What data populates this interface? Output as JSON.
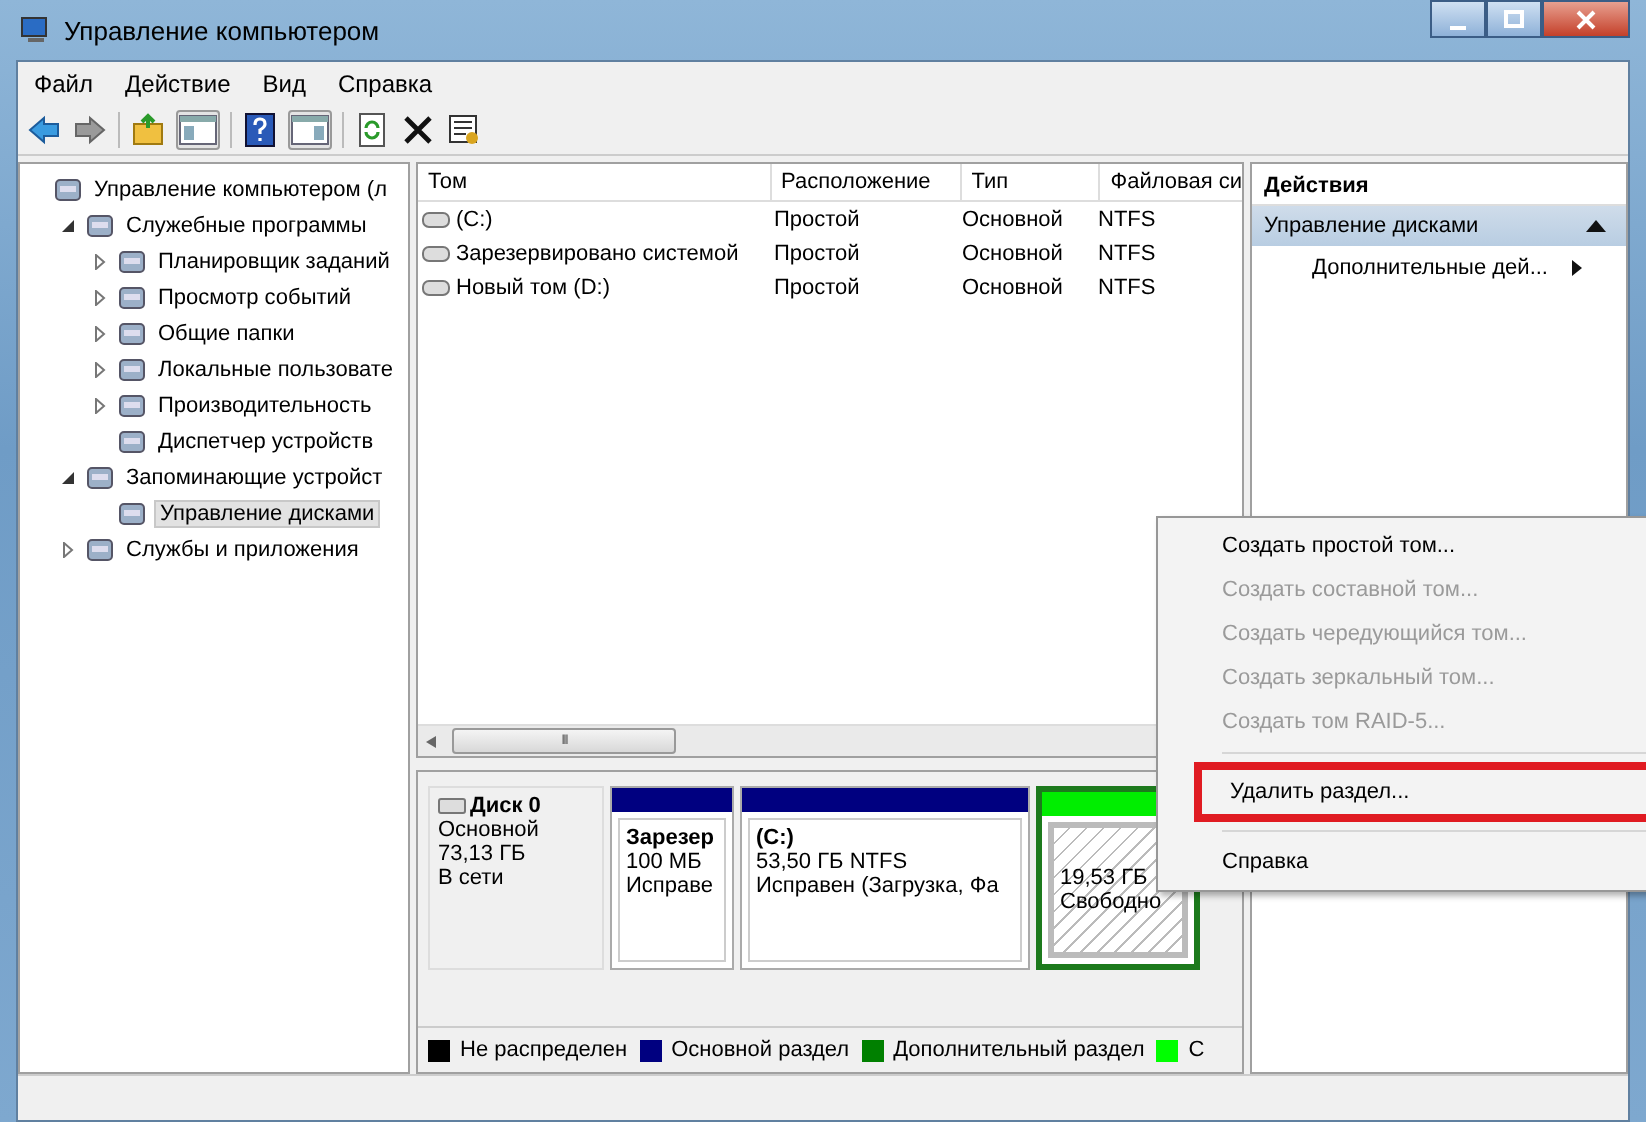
{
  "window": {
    "title": "Управление компьютером"
  },
  "menu": [
    "Файл",
    "Действие",
    "Вид",
    "Справка"
  ],
  "tree": [
    {
      "label": "Управление компьютером (л",
      "selected": false,
      "children": [
        {
          "label": "Служебные программы",
          "expanded": true,
          "selected": false,
          "children": [
            {
              "label": "Планировщик заданий",
              "expanded": false,
              "selected": false
            },
            {
              "label": "Просмотр событий",
              "expanded": false,
              "selected": false
            },
            {
              "label": "Общие папки",
              "expanded": false,
              "selected": false
            },
            {
              "label": "Локальные пользовате",
              "expanded": false,
              "selected": false
            },
            {
              "label": "Производительность",
              "expanded": false,
              "selected": false
            },
            {
              "label": "Диспетчер устройств",
              "selected": false
            }
          ]
        },
        {
          "label": "Запоминающие устройст",
          "expanded": true,
          "selected": false,
          "children": [
            {
              "label": "Управление дисками",
              "selected": true
            }
          ]
        },
        {
          "label": "Службы и приложения",
          "expanded": false,
          "selected": false
        }
      ]
    }
  ],
  "volumes": {
    "columns": [
      "Том",
      "Расположение",
      "Тип",
      "Файловая си"
    ],
    "rows": [
      [
        "(C:)",
        "Простой",
        "Основной",
        "NTFS"
      ],
      [
        "Зарезервировано системой",
        "Простой",
        "Основной",
        "NTFS"
      ],
      [
        "Новый том (D:)",
        "Простой",
        "Основной",
        "NTFS"
      ]
    ],
    "scroll_glyph": "III"
  },
  "actions": {
    "title": "Действия",
    "section": "Управление дисками",
    "items": [
      "Дополнительные дей..."
    ]
  },
  "disk": {
    "name": "Диск 0",
    "lines": [
      "Основной",
      "73,13 ГБ",
      "В сети"
    ],
    "partitions": [
      {
        "kind": "primary",
        "title": "Зарезер",
        "lines": [
          "100 МБ",
          "Исправе"
        ],
        "selected": false
      },
      {
        "kind": "primary",
        "title": "(C:)",
        "lines": [
          "53,50 ГБ NTFS",
          "Исправен (Загрузка, Фа"
        ],
        "selected": false
      },
      {
        "kind": "free",
        "lines": [
          "19,53 ГБ",
          "Свободно"
        ],
        "selected": true
      }
    ]
  },
  "legend": [
    {
      "label": "Не распределен",
      "color": "#000000"
    },
    {
      "label": "Основной раздел",
      "color": "#000080"
    },
    {
      "label": "Дополнительный раздел",
      "color": "#008000"
    },
    {
      "label": "С",
      "color": "#00ff00"
    }
  ],
  "context_menu": [
    {
      "kind": "item",
      "label": "Создать простой том...",
      "disabled": false,
      "highlighted": false
    },
    {
      "kind": "item",
      "label": "Создать составной том...",
      "disabled": true,
      "highlighted": false
    },
    {
      "kind": "item",
      "label": "Создать чередующийся том...",
      "disabled": true,
      "highlighted": false
    },
    {
      "kind": "item",
      "label": "Создать зеркальный том...",
      "disabled": true,
      "highlighted": false
    },
    {
      "kind": "item",
      "label": "Создать том RAID-5...",
      "disabled": true,
      "highlighted": false
    },
    {
      "kind": "separator"
    },
    {
      "kind": "item",
      "label": "Удалить раздел...",
      "disabled": false,
      "highlighted": true
    },
    {
      "kind": "separator"
    },
    {
      "kind": "item",
      "label": "Справка",
      "disabled": false,
      "highlighted": false
    }
  ]
}
